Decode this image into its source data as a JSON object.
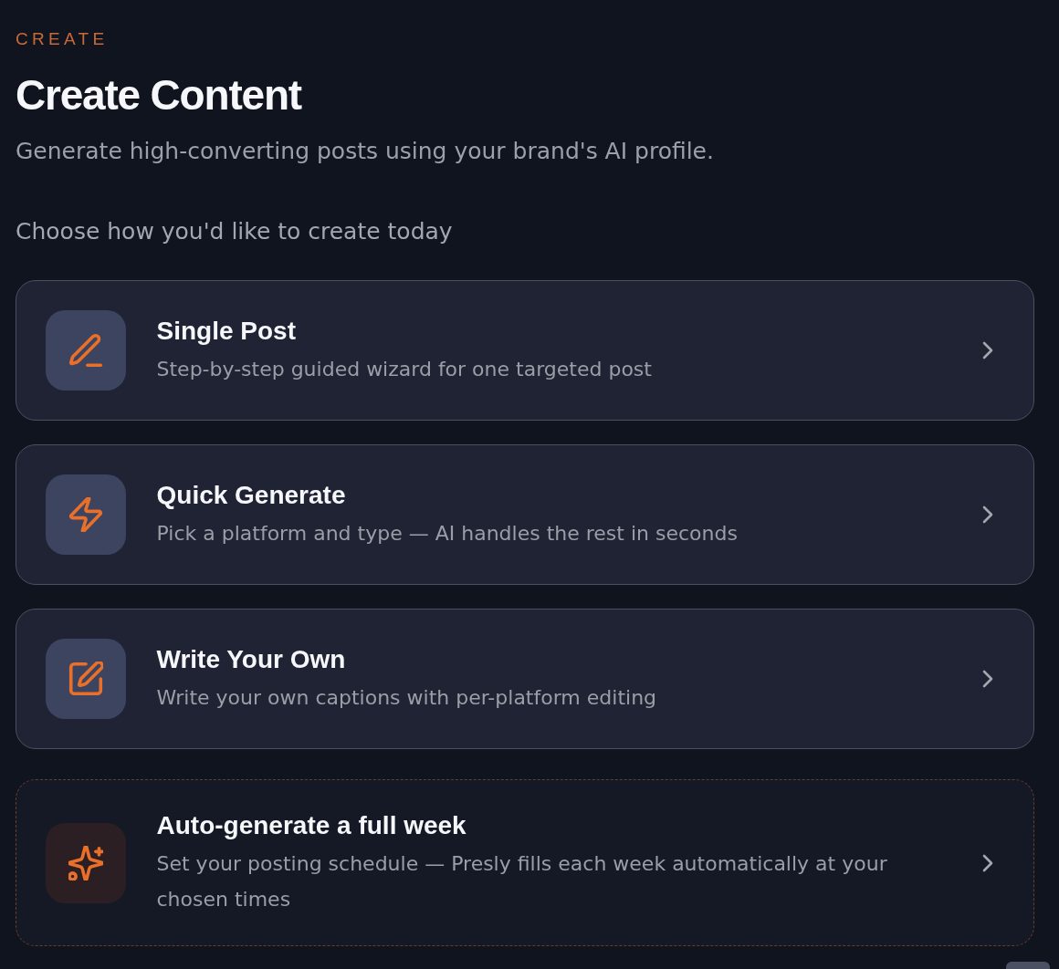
{
  "header": {
    "eyebrow": "CREATE",
    "title": "Create Content",
    "subtitle": "Generate high-converting posts using your brand's AI profile."
  },
  "prompt": "Choose how you'd like to create today",
  "options": [
    {
      "kind": "standard",
      "title": "Single Post",
      "description": "Step-by-step guided wizard for one targeted post"
    },
    {
      "kind": "standard",
      "title": "Quick Generate",
      "description": "Pick a platform and type — AI handles the rest in seconds"
    },
    {
      "kind": "standard",
      "title": "Write Your Own",
      "description": "Write your own captions with per-platform editing"
    },
    {
      "kind": "automation",
      "title": "Auto-generate a full week",
      "description": "Set your posting schedule — Presly fills each week automatically at your chosen times"
    }
  ]
}
